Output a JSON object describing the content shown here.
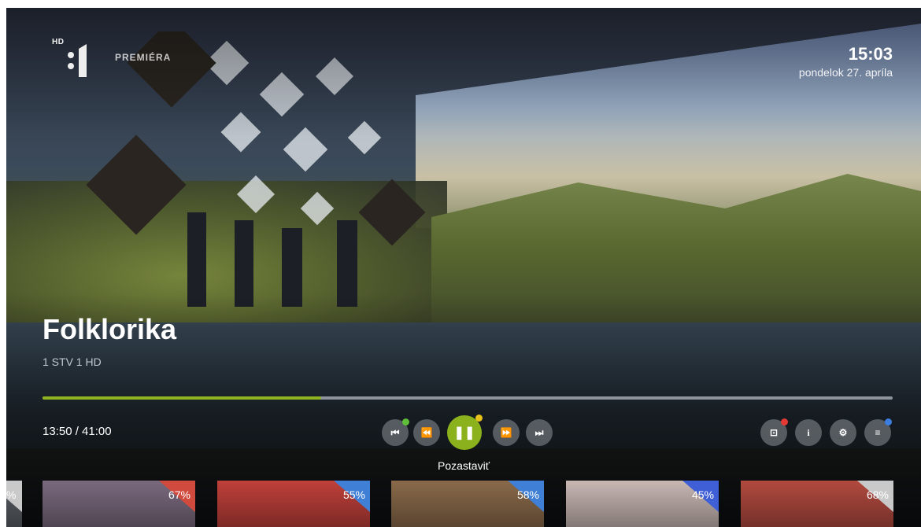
{
  "channel_logo": {
    "hd_label": "HD",
    "number": "1",
    "premiera": "PREMIÉRA"
  },
  "clock": {
    "time": "15:03",
    "date": "pondelok 27. apríla"
  },
  "program": {
    "title": "Folklorika",
    "channel": "1 STV 1 HD"
  },
  "playback": {
    "elapsed_text": "13:50 / 41:00",
    "progress_fraction": 0.328,
    "focused_hint": "Pozastaviť"
  },
  "controls": [
    {
      "name": "skip-back-button",
      "icon": "skip-back-icon",
      "glyph": "⏮",
      "dot_color": "#5fbf3a"
    },
    {
      "name": "rewind-button",
      "icon": "rewind-icon",
      "glyph": "⏪",
      "dot_color": ""
    },
    {
      "name": "pause-button",
      "icon": "pause-icon",
      "glyph": "❚❚",
      "dot_color": "#e8c21a"
    },
    {
      "name": "fast-forward-button",
      "icon": "fast-forward-icon",
      "glyph": "⏩",
      "dot_color": ""
    },
    {
      "name": "skip-forward-button",
      "icon": "skip-forward-icon",
      "glyph": "⏭",
      "dot_color": ""
    }
  ],
  "side_controls": [
    {
      "name": "record-button",
      "icon": "record-icon",
      "glyph": "⊡",
      "dot_color": "#e53935"
    },
    {
      "name": "info-button",
      "icon": "info-icon",
      "glyph": "i",
      "dot_color": ""
    },
    {
      "name": "settings-button",
      "icon": "gear-icon",
      "glyph": "⚙",
      "dot_color": ""
    },
    {
      "name": "menu-button",
      "icon": "menu-icon",
      "glyph": "≡",
      "dot_color": "#3d7de0"
    }
  ],
  "thumbnails": [
    {
      "percent": "%",
      "bg": "#5a5f66",
      "corner": "#c9c9c9"
    },
    {
      "percent": "67%",
      "bg": "#7a6a7e",
      "corner": "#d14a3e"
    },
    {
      "percent": "55%",
      "bg": "#c0403a",
      "corner": "#3f7fd6"
    },
    {
      "percent": "58%",
      "bg": "#8a6a4a",
      "corner": "#3f7fd6"
    },
    {
      "percent": "45%",
      "bg": "#c9b8b4",
      "corner": "#3f5fd6"
    },
    {
      "percent": "68%",
      "bg": "#b24a3f",
      "corner": "#c9c9c9"
    }
  ],
  "colors": {
    "accent": "#8bb21c",
    "progress_track": "#8e949a"
  }
}
